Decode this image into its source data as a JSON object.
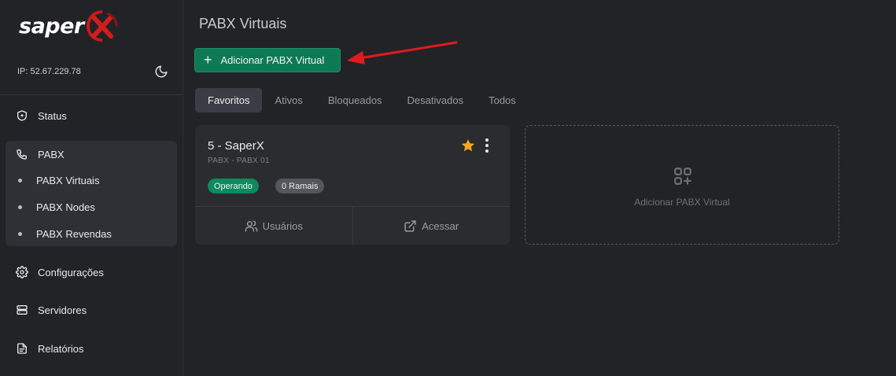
{
  "brand": {
    "name": "saper",
    "mark": "X"
  },
  "sidebar": {
    "ip": "IP: 52.67.229.78",
    "items": {
      "status": "Status",
      "pabx": "PABX",
      "configuracoes": "Configurações",
      "servidores": "Servidores",
      "relatorios": "Relatórios"
    },
    "pabx_sub": [
      "PABX Virtuais",
      "PABX Nodes",
      "PABX Revendas"
    ]
  },
  "main": {
    "title": "PABX Virtuais",
    "add_button": "Adicionar PABX Virtual",
    "tabs": [
      "Favoritos",
      "Ativos",
      "Bloqueados",
      "Desativados",
      "Todos"
    ],
    "active_tab": "Favoritos",
    "card": {
      "title": "5 - SaperX",
      "subtitle": "PABX - PABX 01",
      "status_badge": "Operando",
      "ramais_badge": "0 Ramais",
      "users_label": "Usuários",
      "access_label": "Acessar"
    },
    "add_card_label": "Adicionar PABX Virtual"
  },
  "colors": {
    "background": "#222327",
    "accent_green": "#0e7a55",
    "star": "#f5a623",
    "annotation_arrow": "#e01b1b"
  }
}
